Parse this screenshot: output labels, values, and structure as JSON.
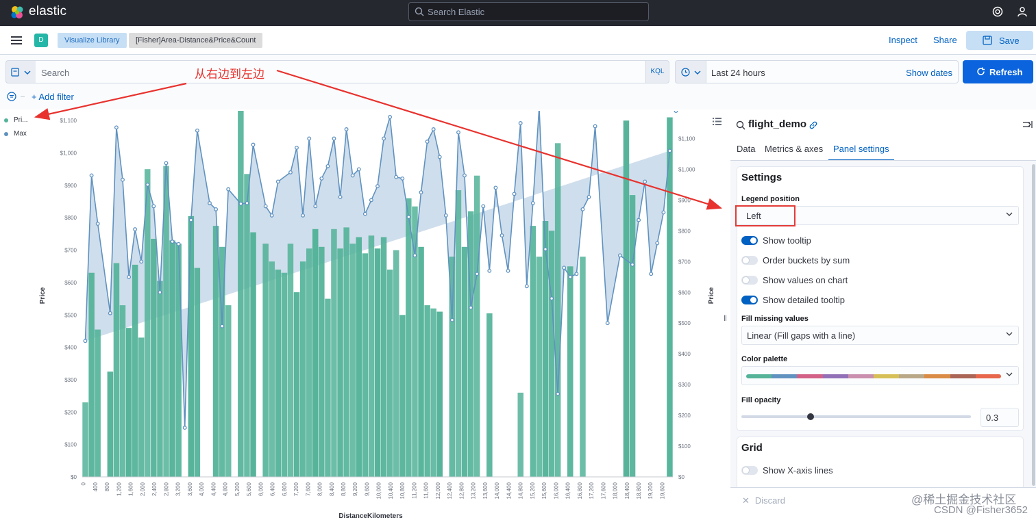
{
  "header": {
    "brand": "elastic",
    "search_placeholder": "Search Elastic"
  },
  "navbar": {
    "space_initial": "D",
    "breadcrumbs": [
      "Visualize Library",
      "[Fisher]Area-Distance&Price&Count"
    ],
    "inspect": "Inspect",
    "share": "Share",
    "save": "Save"
  },
  "query": {
    "placeholder": "Search",
    "language": "KQL",
    "time_range": "Last 24 hours",
    "show_dates": "Show dates",
    "refresh": "Refresh",
    "add_filter": "+ Add filter"
  },
  "annotation": "从右边到左边",
  "legend": [
    {
      "label": "Pri...",
      "color": "#54b399"
    },
    {
      "label": "Max",
      "color": "#6092c0"
    }
  ],
  "chart_data": {
    "type": "bar",
    "xlabel": "DistanceKilometers",
    "ylabel_left": "Price",
    "ylabel_right": "Price",
    "x_ticks": [
      "0",
      "400",
      "800",
      "1,200",
      "1,600",
      "2,000",
      "2,400",
      "2,800",
      "3,200",
      "3,600",
      "4,000",
      "4,400",
      "4,800",
      "5,200",
      "5,600",
      "6,000",
      "6,400",
      "6,800",
      "7,200",
      "7,600",
      "8,000",
      "8,400",
      "8,800",
      "9,200",
      "9,600",
      "10,000",
      "10,400",
      "10,800",
      "11,200",
      "11,600",
      "12,000",
      "12,400",
      "12,800",
      "13,200",
      "13,600",
      "14,000",
      "14,400",
      "14,800",
      "15,200",
      "15,600",
      "16,000",
      "16,400",
      "16,800",
      "17,200",
      "17,600",
      "18,000",
      "18,400",
      "18,800",
      "19,200",
      "19,600"
    ],
    "y_ticks_left": [
      "$0",
      "$100",
      "$200",
      "$300",
      "$400",
      "$500",
      "$600",
      "$700",
      "$800",
      "$900",
      "$1,000",
      "$1,100"
    ],
    "y_ticks_right": [
      "$0",
      "$100",
      "$200",
      "$300",
      "$400",
      "$500",
      "$600",
      "$700",
      "$800",
      "$900",
      "$1,000",
      "$1,100"
    ],
    "ylim_left": [
      0,
      1130
    ],
    "ylim_right": [
      0,
      1190
    ],
    "series": [
      {
        "name": "Pri...",
        "kind": "bar",
        "color": "#54b399",
        "values": [
          230,
          630,
          455,
          0,
          325,
          660,
          530,
          460,
          655,
          430,
          950,
          735,
          605,
          960,
          730,
          720,
          0,
          805,
          645,
          0,
          0,
          775,
          710,
          530,
          0,
          1130,
          935,
          755,
          0,
          720,
          665,
          640,
          630,
          720,
          570,
          665,
          705,
          765,
          710,
          550,
          765,
          705,
          770,
          720,
          740,
          690,
          745,
          705,
          740,
          640,
          700,
          500,
          860,
          835,
          710,
          530,
          520,
          510,
          0,
          680,
          885,
          710,
          820,
          930,
          0,
          505,
          0,
          0,
          0,
          0,
          260,
          0,
          775,
          680,
          790,
          760,
          1030,
          0,
          650,
          0,
          680,
          0,
          0,
          0,
          0,
          0,
          0,
          1100,
          870,
          0,
          0,
          0,
          0,
          0,
          1110
        ],
        "color_ramp": true
      },
      {
        "name": "Max",
        "kind": "area",
        "color": "#6092c0",
        "fill_opacity": 0.3,
        "x_index": [
          0,
          1,
          2,
          4,
          5,
          6,
          7,
          8,
          9,
          10,
          11,
          12,
          13,
          14,
          15,
          16,
          17,
          18,
          20,
          21,
          22,
          23,
          25,
          26,
          27,
          29,
          30,
          31,
          33,
          34,
          35,
          36,
          37,
          38,
          39,
          40,
          41,
          42,
          43,
          44,
          45,
          46,
          47,
          48,
          49,
          50,
          51,
          52,
          53,
          54,
          55,
          56,
          57,
          58,
          59,
          60,
          61,
          62,
          63,
          64,
          65,
          66,
          67,
          68,
          69,
          70,
          71,
          72,
          73,
          74,
          75,
          76,
          77,
          78,
          79,
          80,
          81,
          82,
          84,
          86,
          88,
          89,
          90,
          91,
          92,
          93,
          94,
          95
        ],
        "values": [
          442,
          980,
          823,
          532,
          1136,
          966,
          650,
          805,
          700,
          950,
          880,
          600,
          1020,
          765,
          757,
          160,
          835,
          1126,
          890,
          870,
          490,
          935,
          888,
          890,
          1080,
          880,
          850,
          960,
          990,
          1070,
          850,
          1100,
          880,
          970,
          1010,
          1100,
          910,
          1130,
          980,
          1000,
          855,
          900,
          945,
          1100,
          1170,
          975,
          970,
          845,
          720,
          925,
          1090,
          1130,
          1040,
          850,
          510,
          1120,
          980,
          550,
          660,
          880,
          670,
          940,
          785,
          670,
          920,
          1150,
          620,
          890,
          1200,
          740,
          580,
          270,
          680,
          650,
          660,
          870,
          910,
          1140,
          500,
          720,
          690,
          835,
          960,
          660,
          760,
          860,
          1060
        ],
        "note_x_indices": "positions along the 96 bar slots"
      }
    ]
  },
  "editor": {
    "title": "flight_demo",
    "tabs": [
      "Data",
      "Metrics & axes",
      "Panel settings"
    ],
    "active_tab": "Panel settings",
    "settings_heading": "Settings",
    "legend_position_label": "Legend position",
    "legend_position_value": "Left",
    "toggles": [
      {
        "label": "Show tooltip",
        "on": true
      },
      {
        "label": "Order buckets by sum",
        "on": false
      },
      {
        "label": "Show values on chart",
        "on": false
      },
      {
        "label": "Show detailed tooltip",
        "on": true
      }
    ],
    "fill_missing_label": "Fill missing values",
    "fill_missing_value": "Linear (Fill gaps with a line)",
    "color_palette_label": "Color palette",
    "palette_colors": [
      "#54b399",
      "#6092c0",
      "#d36086",
      "#9170b8",
      "#ca8eae",
      "#d6bf57",
      "#b9a888",
      "#da8b45",
      "#aa6556",
      "#e7664c"
    ],
    "fill_opacity_label": "Fill opacity",
    "fill_opacity_value": "0.3",
    "fill_opacity_fraction": 0.3,
    "grid_heading": "Grid",
    "grid_toggle": "Show X-axis lines",
    "discard": "Discard"
  },
  "watermark": {
    "line1": "@稀土掘金技术社区",
    "line2": "CSDN @Fisher3652"
  }
}
